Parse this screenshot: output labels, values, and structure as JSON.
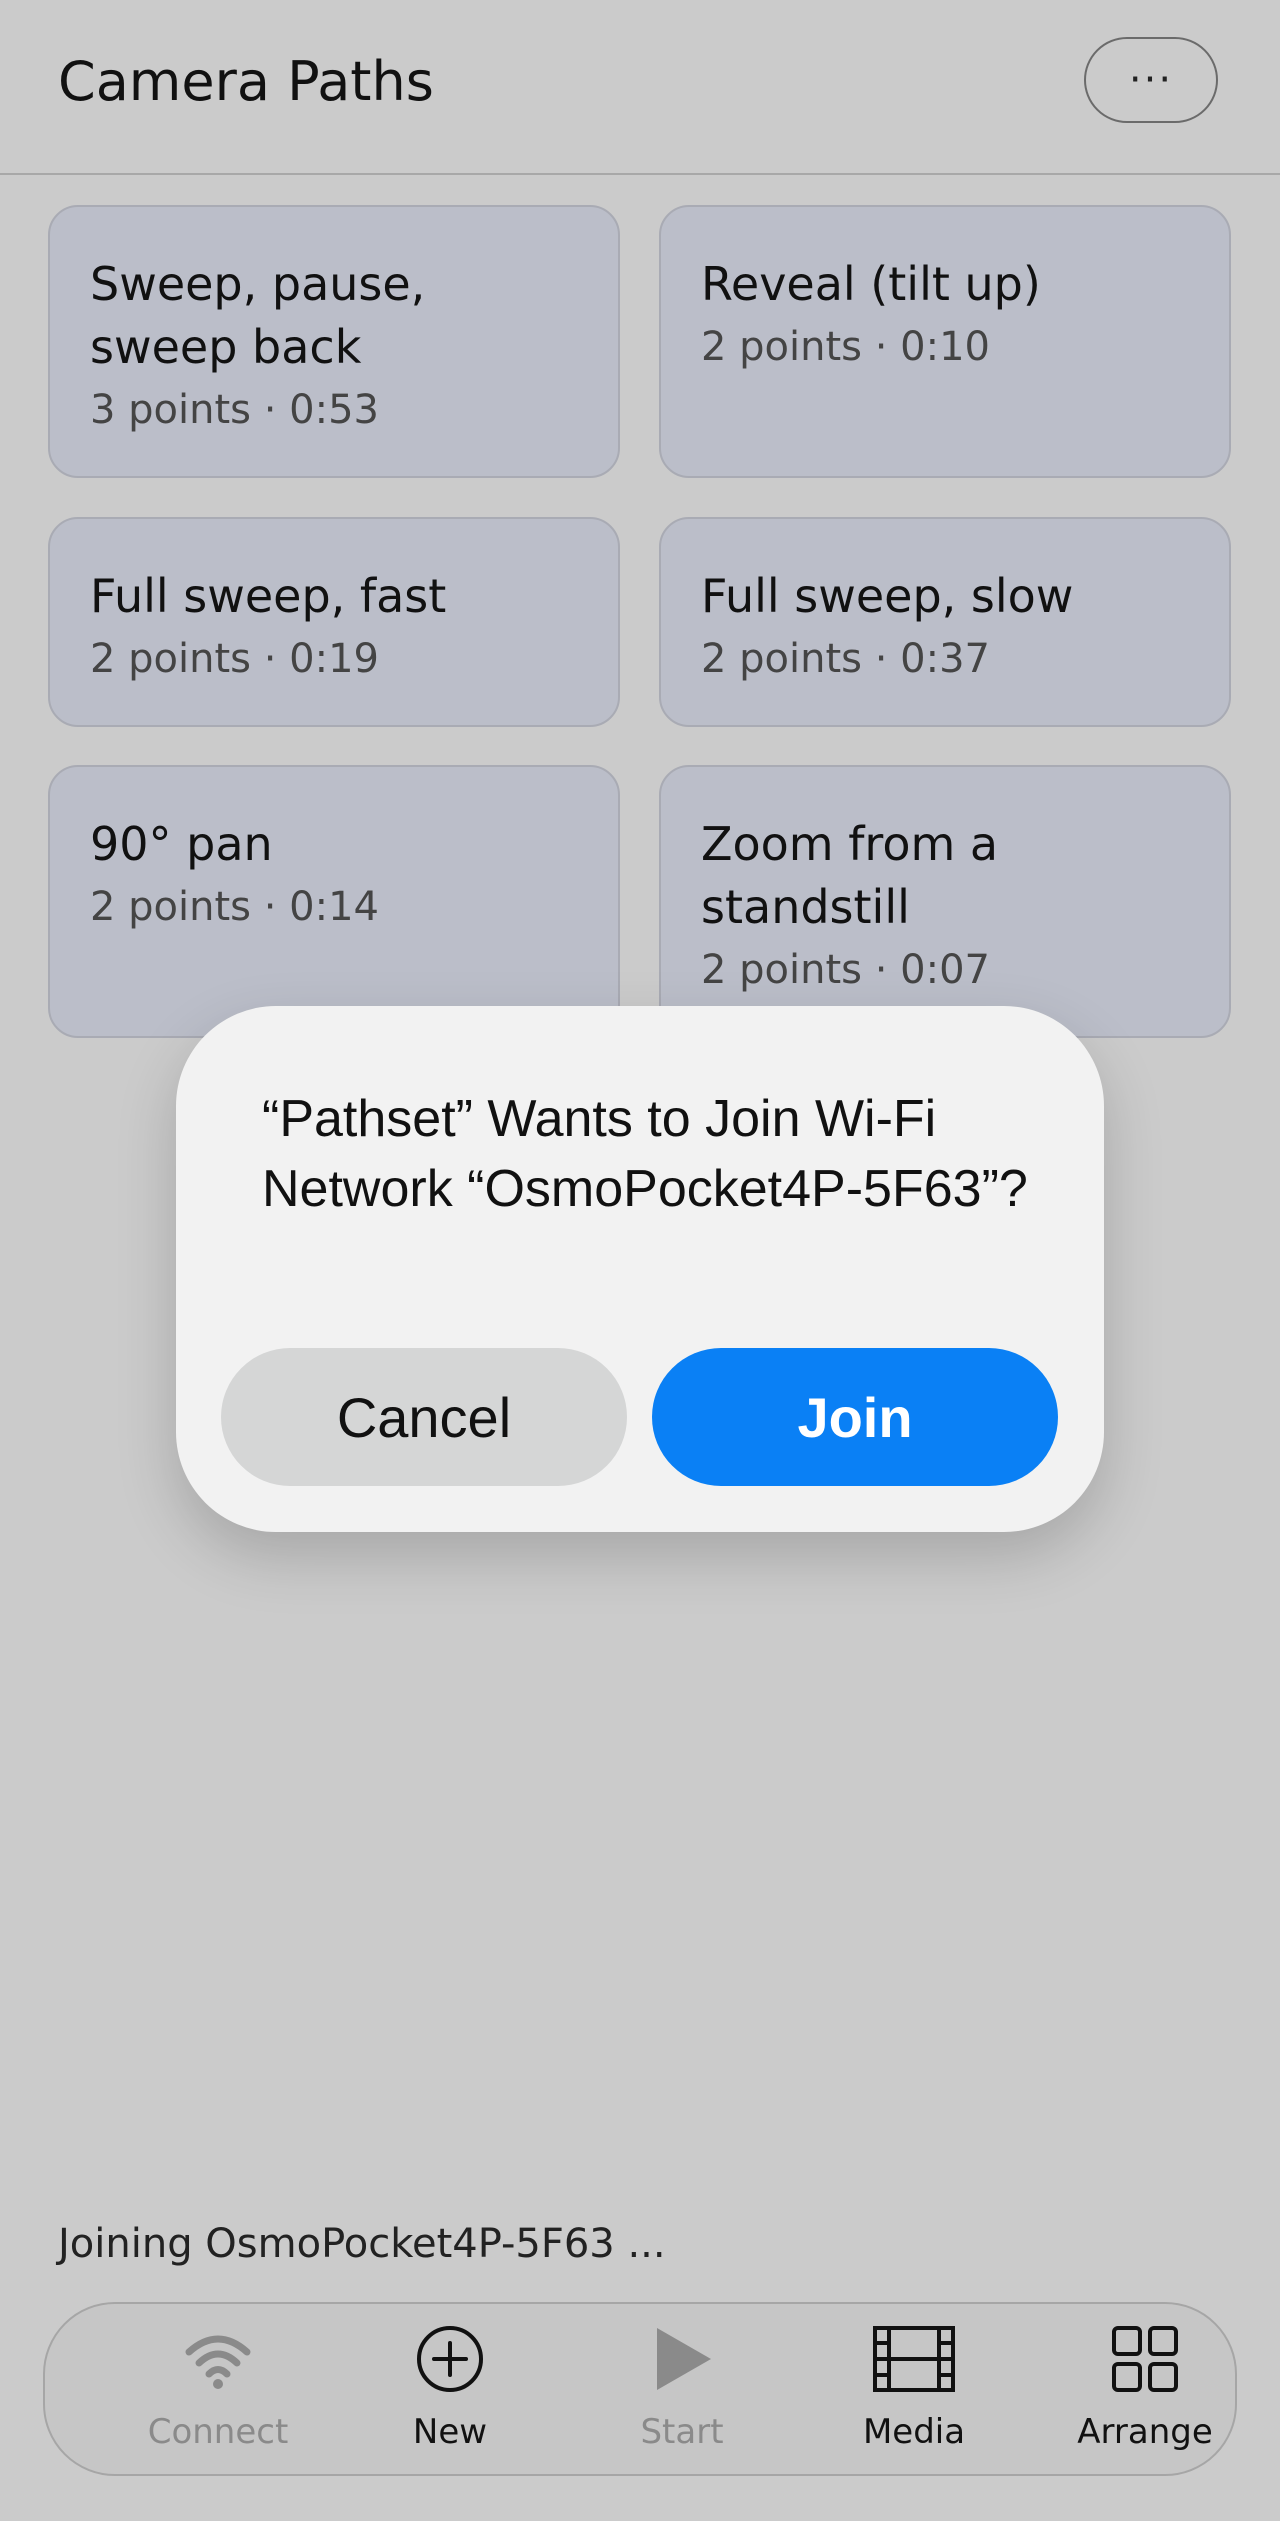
{
  "header": {
    "title": "Camera Paths",
    "more_label": "···"
  },
  "paths": [
    {
      "title": "Sweep, pause, sweep back",
      "meta": "3 points · 0:53"
    },
    {
      "title": "Reveal (tilt up)",
      "meta": "2 points · 0:10"
    },
    {
      "title": "Full sweep, fast",
      "meta": "2 points · 0:19"
    },
    {
      "title": "Full sweep, slow",
      "meta": "2 points · 0:37"
    },
    {
      "title": "90° pan",
      "meta": "2 points · 0:14"
    },
    {
      "title": "Zoom from a standstill",
      "meta": "2 points · 0:07"
    }
  ],
  "dialog": {
    "message": "“Pathset” Wants to Join Wi-Fi Network “OsmoPocket4P-5F63”?",
    "cancel_label": "Cancel",
    "join_label": "Join",
    "join_color": "#0a80f5"
  },
  "status": {
    "text": "Joining OsmoPocket4P-5F63 ..."
  },
  "tabbar": {
    "items": [
      {
        "label": "Connect",
        "icon": "wifi-icon",
        "enabled": false
      },
      {
        "label": "New",
        "icon": "plus-circle-icon",
        "enabled": true
      },
      {
        "label": "Start",
        "icon": "play-icon",
        "enabled": false
      },
      {
        "label": "Media",
        "icon": "film-icon",
        "enabled": true
      },
      {
        "label": "Arrange",
        "icon": "grid-icon",
        "enabled": true
      }
    ]
  }
}
